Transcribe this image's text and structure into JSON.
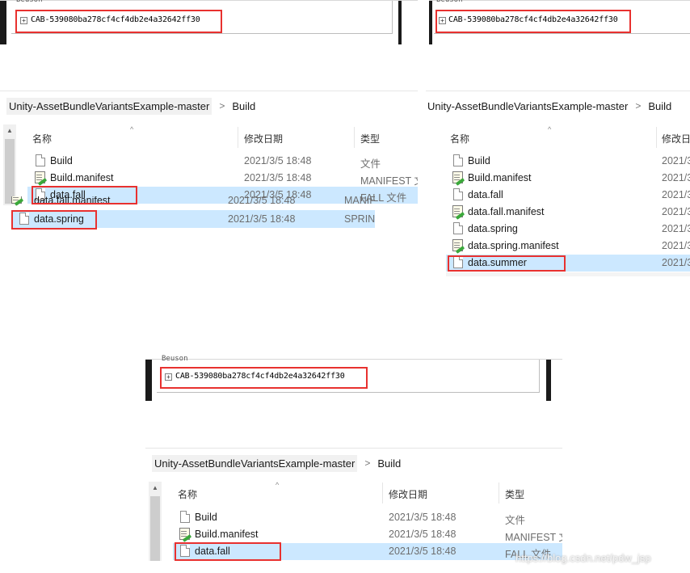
{
  "cab_label": "CAB-539080ba278cf4cf4db2e4a32642ff30",
  "cut_text": "Beuson",
  "expand_glyph": "+",
  "breadcrumb": {
    "folder": "Unity-AssetBundleVariantsExample-master",
    "sep": ">",
    "current": "Build"
  },
  "columns": {
    "name": "名称",
    "date": "修改日期",
    "type": "类型"
  },
  "sort_caret": "^",
  "scroll_up_glyph": "▲",
  "panel_left": {
    "rows": [
      {
        "name": "Build",
        "date": "2021/3/5 18:48",
        "type": "文件"
      },
      {
        "name": "Build.manifest",
        "date": "2021/3/5 18:48",
        "type": "MANIFEST 文件"
      },
      {
        "name": "data.fall",
        "date": "2021/3/5 18:48",
        "type": "FALL 文件"
      }
    ],
    "overlay_hidden": {
      "name": "data.fall.manifest",
      "date": "2021/3/5 18:48",
      "type": "MANIFEST"
    },
    "overlay_selected": {
      "name": "data.spring",
      "date": "2021/3/5 18:48",
      "type": "SPRING"
    }
  },
  "panel_right": {
    "rows": [
      {
        "name": "Build",
        "date": "2021/3"
      },
      {
        "name": "Build.manifest",
        "date": "2021/3"
      },
      {
        "name": "data.fall",
        "date": "2021/3"
      },
      {
        "name": "data.fall.manifest",
        "date": "2021/3"
      },
      {
        "name": "data.spring",
        "date": "2021/3"
      },
      {
        "name": "data.spring.manifest",
        "date": "2021/3"
      },
      {
        "name": "data.summer",
        "date": "2021/3"
      }
    ],
    "header_date_cut": "修改日"
  },
  "panel_bottom": {
    "rows": [
      {
        "name": "Build",
        "date": "2021/3/5 18:48",
        "type": "文件"
      },
      {
        "name": "Build.manifest",
        "date": "2021/3/5 18:48",
        "type": "MANIFEST 文"
      },
      {
        "name": "data.fall",
        "date": "2021/3/5 18:48",
        "type": "FALL 文件"
      }
    ]
  },
  "watermark": "https://blog.csdn.net/pdw_jsp",
  "colors": {
    "highlight_box": "#e8312f",
    "selection": "#cce8ff"
  }
}
